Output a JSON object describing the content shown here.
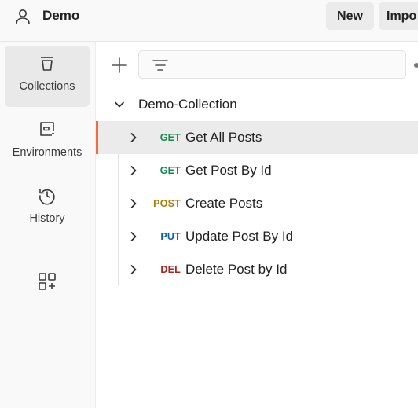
{
  "header": {
    "workspace_icon": "user-icon",
    "workspace_name": "Demo",
    "new_label": "New",
    "import_label": "Impo"
  },
  "sidebar": {
    "items": [
      {
        "label": "Collections",
        "icon": "trash-can-icon",
        "active": true
      },
      {
        "label": "Environments",
        "icon": "environment-icon",
        "active": false
      },
      {
        "label": "History",
        "icon": "history-icon",
        "active": false
      }
    ],
    "extra_icon": "add-widget-icon"
  },
  "toolbar": {
    "add_icon": "plus-icon",
    "filter_icon": "filter-icon"
  },
  "collection": {
    "name": "Demo-Collection",
    "expanded": true,
    "requests": [
      {
        "method": "GET",
        "name": "Get All Posts",
        "active": true
      },
      {
        "method": "GET",
        "name": "Get Post By Id",
        "active": false
      },
      {
        "method": "POST",
        "name": "Create Posts",
        "active": false
      },
      {
        "method": "PUT",
        "name": "Update Post By Id",
        "active": false
      },
      {
        "method": "DEL",
        "name": "Delete Post by Id",
        "active": false
      }
    ]
  },
  "colors": {
    "accent": "#f26b3a",
    "GET": "#0f8a4a",
    "POST": "#ad7a03",
    "PUT": "#0b5fb5",
    "DEL": "#a8261d"
  }
}
